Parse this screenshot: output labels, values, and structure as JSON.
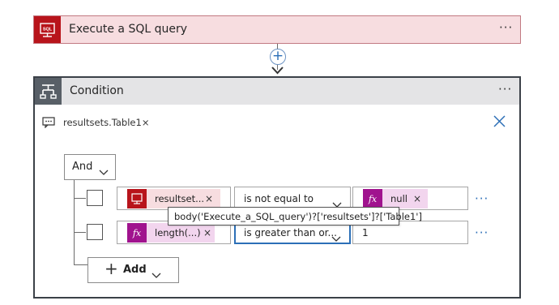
{
  "sql_action": {
    "title": "Execute a SQL query",
    "more": "···"
  },
  "condition": {
    "title": "Condition",
    "more": "···",
    "token_text": "resultsets.Table1",
    "token_remove": "×",
    "logic_operator": "And",
    "rows": [
      {
        "left_token": "resultset...",
        "left_remove": "×",
        "operator": "is not equal to",
        "right_token": "null",
        "right_remove": "×",
        "more": "···"
      },
      {
        "left_token": "length(...)",
        "left_remove": "×",
        "operator": "is greater than or...",
        "right_value": "1",
        "more": "···"
      }
    ],
    "tooltip": "body('Execute_a_SQL_query')?['resultsets']?['Table1']",
    "add_button": {
      "plus": "+",
      "label": "Add"
    }
  },
  "connector": {
    "add_symbol": "+"
  },
  "colors": {
    "sql_red": "#b8141b",
    "sql_card_bg": "#f7dde0",
    "condition_header_bg": "#e4e4e6",
    "condition_icon_bg": "#585f67",
    "fx_purple": "#a0138e",
    "fx_token_bg": "#f2d5ee",
    "accent_blue": "#2c6fb7"
  },
  "icons": {
    "sql": "sql-server-icon",
    "condition": "condition-icon",
    "comment": "comment-icon",
    "close": "close-icon",
    "expression": "fx-icon",
    "chevron": "chevron-down-icon"
  }
}
